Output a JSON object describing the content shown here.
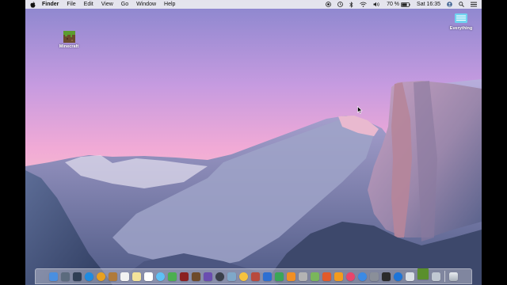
{
  "menubar": {
    "app_name": "Finder",
    "menus": [
      "File",
      "Edit",
      "View",
      "Go",
      "Window",
      "Help"
    ],
    "battery": "70 %",
    "clock": "Sat 16:35",
    "status_icons": [
      "record-icon",
      "time-machine-icon",
      "bluetooth-icon",
      "wifi-icon",
      "volume-icon",
      "battery-icon",
      "user-icon",
      "search-icon",
      "notification-center-icon"
    ]
  },
  "desktop": {
    "icons": [
      {
        "label": "Minecraft",
        "icon": "minecraft-icon"
      },
      {
        "label": "Everything",
        "icon": "everything-icon"
      }
    ]
  },
  "dock": {
    "apps": [
      {
        "name": "finder-icon",
        "color": "#4a8fe0"
      },
      {
        "name": "launchpad-icon",
        "color": "#5b6b7e"
      },
      {
        "name": "mission-control-icon",
        "color": "#2f3e55"
      },
      {
        "name": "safari-icon",
        "color": "#1f8be0"
      },
      {
        "name": "chrome-icon",
        "color": "#e8a020"
      },
      {
        "name": "contacts-icon",
        "color": "#b07a3a"
      },
      {
        "name": "calendar-icon",
        "color": "#f2f2f2"
      },
      {
        "name": "notes-icon",
        "color": "#f4e39a"
      },
      {
        "name": "reminders-icon",
        "color": "#ffffff"
      },
      {
        "name": "messages-icon",
        "color": "#5ec0f5"
      },
      {
        "name": "facetime-icon",
        "color": "#4caf50"
      },
      {
        "name": "photo-booth-icon",
        "color": "#8b2020"
      },
      {
        "name": "chess-icon",
        "color": "#6e4a2a"
      },
      {
        "name": "imovie-icon",
        "color": "#6a4db0"
      },
      {
        "name": "quicktime-icon",
        "color": "#3a3f4a"
      },
      {
        "name": "preview-icon",
        "color": "#7fa8c9"
      },
      {
        "name": "photos-icon",
        "color": "#f6c23e"
      },
      {
        "name": "photo-app-icon",
        "color": "#b84a3e"
      },
      {
        "name": "keynote-icon",
        "color": "#2d6fd2"
      },
      {
        "name": "numbers-icon",
        "color": "#3aa657"
      },
      {
        "name": "pages-icon",
        "color": "#f08f24"
      },
      {
        "name": "dictionary-icon",
        "color": "#b3b3b3"
      },
      {
        "name": "maps-icon",
        "color": "#7ab65b"
      },
      {
        "name": "garageband-icon",
        "color": "#e25a2b"
      },
      {
        "name": "ibooks-icon",
        "color": "#f39b1d"
      },
      {
        "name": "itunes-icon",
        "color": "#e8456b"
      },
      {
        "name": "app-store-icon",
        "color": "#3b8ae6"
      },
      {
        "name": "system-preferences-icon",
        "color": "#8a8f99"
      },
      {
        "name": "activity-monitor-icon",
        "color": "#2b2b2b"
      },
      {
        "name": "network-icon",
        "color": "#1d74d8"
      },
      {
        "name": "downloads-icon",
        "color": "#d9dfe6"
      },
      {
        "name": "minecraft-icon",
        "color": "#5a8f2c"
      },
      {
        "name": "finder-window-icon",
        "color": "#c0c8d2"
      }
    ],
    "trash": "trash-icon"
  }
}
